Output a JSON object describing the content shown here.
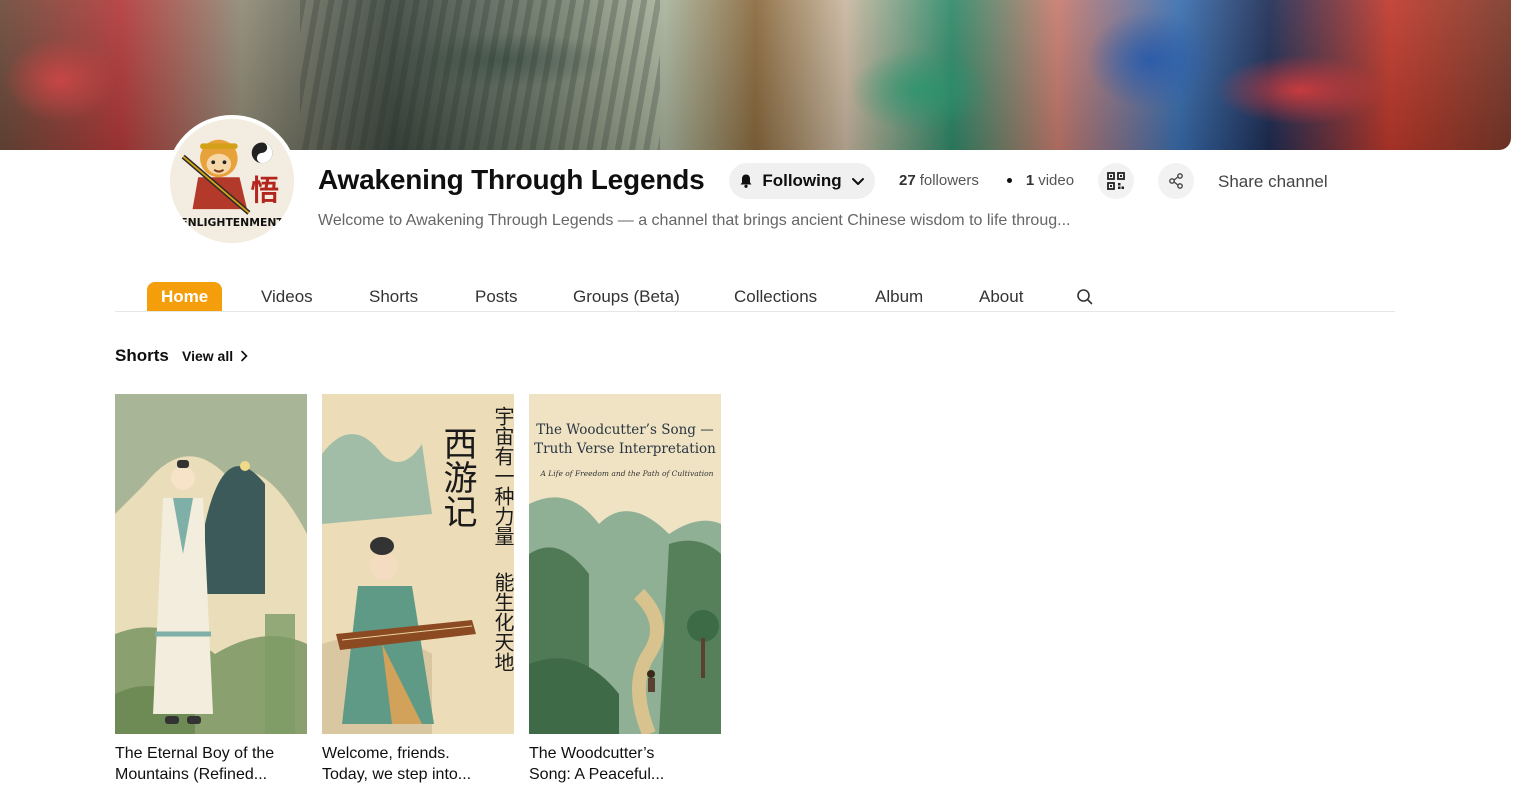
{
  "channel": {
    "name": "Awakening Through Legends",
    "avatar_text": "ENLIGHTENMENT",
    "avatar_glyph": "悟",
    "follow_label": "Following",
    "followers_count": "27",
    "followers_label": "followers",
    "videos_count": "1",
    "videos_label": "video",
    "share_label": "Share channel",
    "description": "Welcome to Awakening Through Legends — a channel that brings ancient Chinese wisdom to life throug..."
  },
  "tabs": [
    {
      "label": "Home",
      "active": true
    },
    {
      "label": "Videos"
    },
    {
      "label": "Shorts"
    },
    {
      "label": "Posts"
    },
    {
      "label": "Groups (Beta)"
    },
    {
      "label": "Collections"
    },
    {
      "label": "Album"
    },
    {
      "label": "About"
    }
  ],
  "shorts": {
    "title": "Shorts",
    "view_all": "View all",
    "items": [
      {
        "title_line1": "The Eternal Boy of the",
        "title_line2": "Mountains (Refined..."
      },
      {
        "title_line1": "Welcome, friends.",
        "title_line2": "Today, we step into...",
        "thumb_title": "西游记",
        "thumb_verse1": "宇宙有一种力量",
        "thumb_verse2": "能生化天地"
      },
      {
        "title_line1": "The Woodcutter’s",
        "title_line2": "Song: A Peaceful...",
        "thumb_title1": "The Woodcutter’s Song —",
        "thumb_title2": "Truth Verse Interpretation",
        "thumb_subtitle": "A Life of Freedom and the Path of Cultivation"
      }
    ]
  },
  "icons": [
    "bell-icon",
    "chevron-down-icon",
    "qr-code-icon",
    "share-icon",
    "search-icon",
    "chevron-right-icon"
  ],
  "colors": {
    "accent": "#f59e0b",
    "button_bg": "#f0f0f0"
  }
}
